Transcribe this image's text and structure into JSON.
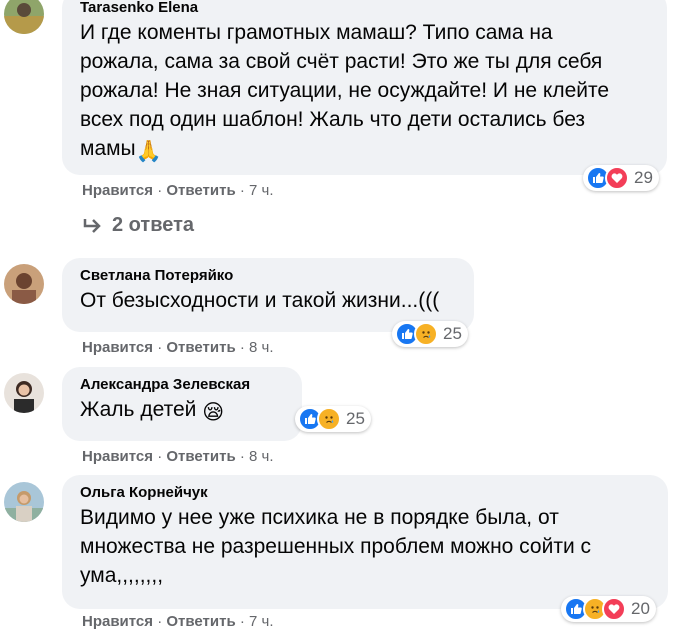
{
  "colors": {
    "like": "#1877f2",
    "love": "#f33e58",
    "sad": "#f7b125",
    "bubble": "#f0f2f5",
    "meta": "#65676b"
  },
  "comments": [
    {
      "author": "Tarasenko Elena",
      "lines": [
        "И где коменты грамотных мамаш? Типо сама на",
        "рожала, сама за свой счёт расти! Это же ты для себя",
        "рожала! Не зная ситуации, не осуждайте! И не клейте",
        "всех под один шаблон! Жаль что дети остались без",
        "мамы"
      ],
      "emoji": "🙏",
      "reactions": [
        "like-icon",
        "love-icon"
      ],
      "count": "29",
      "like": "Нравится",
      "reply": "Ответить",
      "time": "7 ч."
    },
    {
      "author": "Светлана Потеряйко",
      "lines": [
        "От безысходности и такой жизни...((("
      ],
      "reactions": [
        "like-icon",
        "sad-icon"
      ],
      "count": "25",
      "like": "Нравится",
      "reply": "Ответить",
      "time": "8 ч."
    },
    {
      "author": "Александра Зелевская",
      "lines": [
        "Жаль детей"
      ],
      "emoji": "😪",
      "reactions": [
        "like-icon",
        "sad-icon"
      ],
      "count": "25",
      "like": "Нравится",
      "reply": "Ответить",
      "time": "8 ч."
    },
    {
      "author": "Ольга Корнейчук",
      "lines": [
        "Видимо у нее уже психика не в порядке была, от",
        "множества не разрешенных проблем можно сойти с",
        "ума,,,,,,,,"
      ],
      "reactions": [
        "like-icon",
        "sad-icon",
        "love-icon"
      ],
      "count": "20",
      "like": "Нравится",
      "reply": "Ответить",
      "time": "7 ч."
    }
  ],
  "replies_label": "2 ответа",
  "separator": " · "
}
